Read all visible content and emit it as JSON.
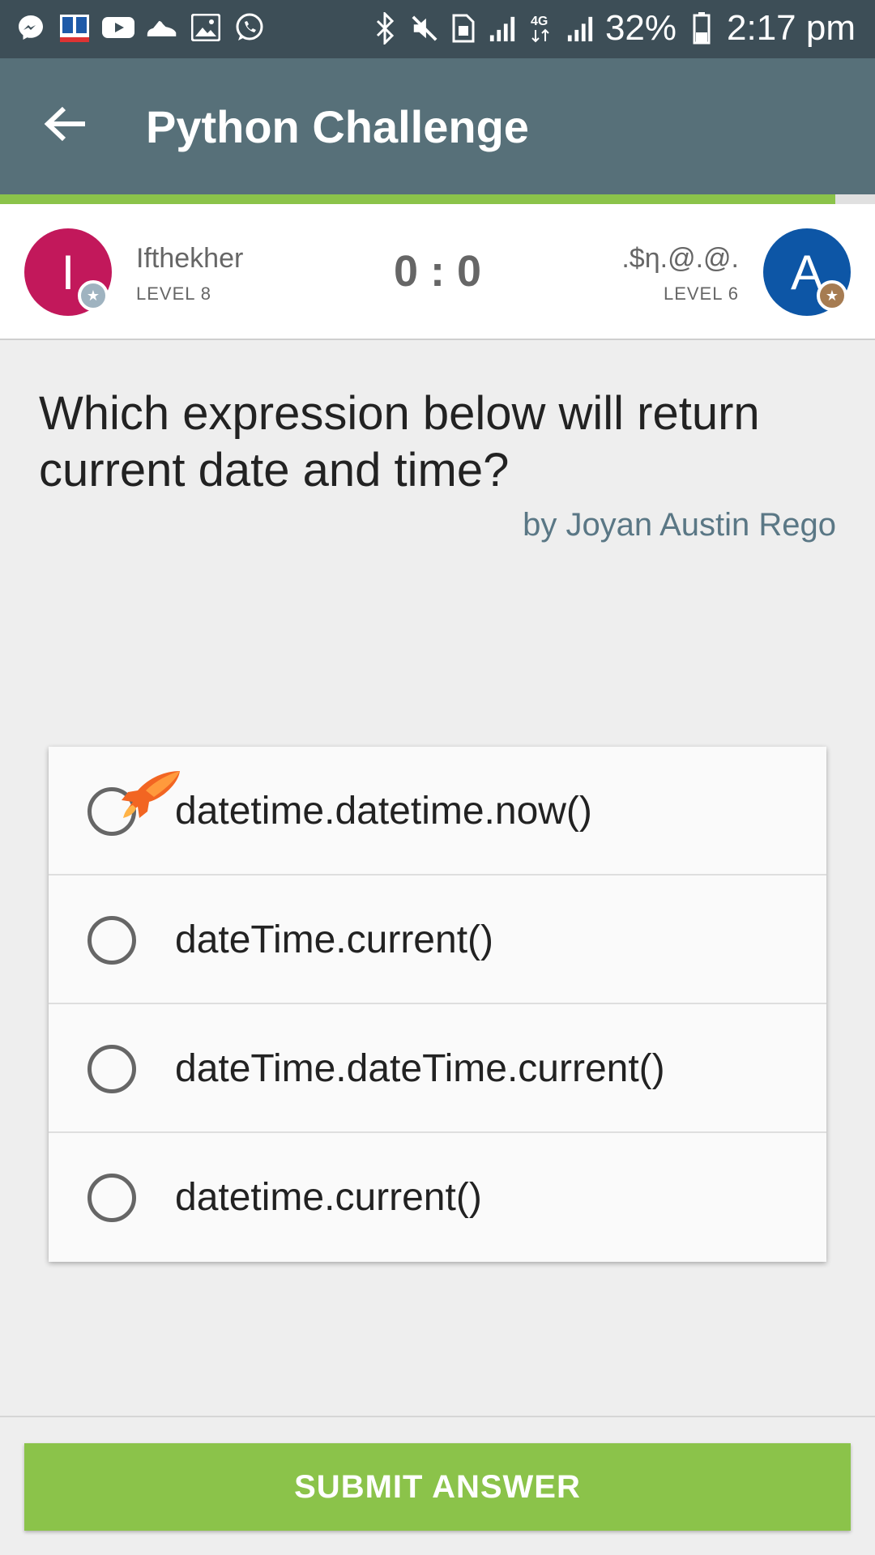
{
  "status_bar": {
    "left_icons": [
      "messenger-icon",
      "dictionary-app-icon",
      "youtube-icon",
      "sneaker-icon",
      "gallery-icon",
      "whatsapp-icon"
    ],
    "right_icons": [
      "bluetooth-icon",
      "mute-icon",
      "sim-icon",
      "signal-icon",
      "4g-icon",
      "signal-icon"
    ],
    "battery": "32%",
    "time": "2:17 pm"
  },
  "app_bar": {
    "title": "Python Challenge"
  },
  "progress": {
    "fraction": 0.955,
    "color": "#8bc34a"
  },
  "players": {
    "left": {
      "initial": "I",
      "name": "Ifthekher",
      "level": "LEVEL 8",
      "color": "#c2185b"
    },
    "right": {
      "initial": "A",
      "name": ".$η.@.@.",
      "level": "LEVEL 6",
      "color": "#0d56a6"
    },
    "score": "0 : 0"
  },
  "question": {
    "text": "Which expression below will return current date and time?",
    "author": "by Joyan Austin Rego"
  },
  "options": [
    {
      "label": "datetime.datetime.now()"
    },
    {
      "label": "dateTime.current()"
    },
    {
      "label": "dateTime.dateTime.current()"
    },
    {
      "label": "datetime.current()"
    }
  ],
  "submit": {
    "label": "SUBMIT ANSWER",
    "color": "#8bc34a"
  }
}
